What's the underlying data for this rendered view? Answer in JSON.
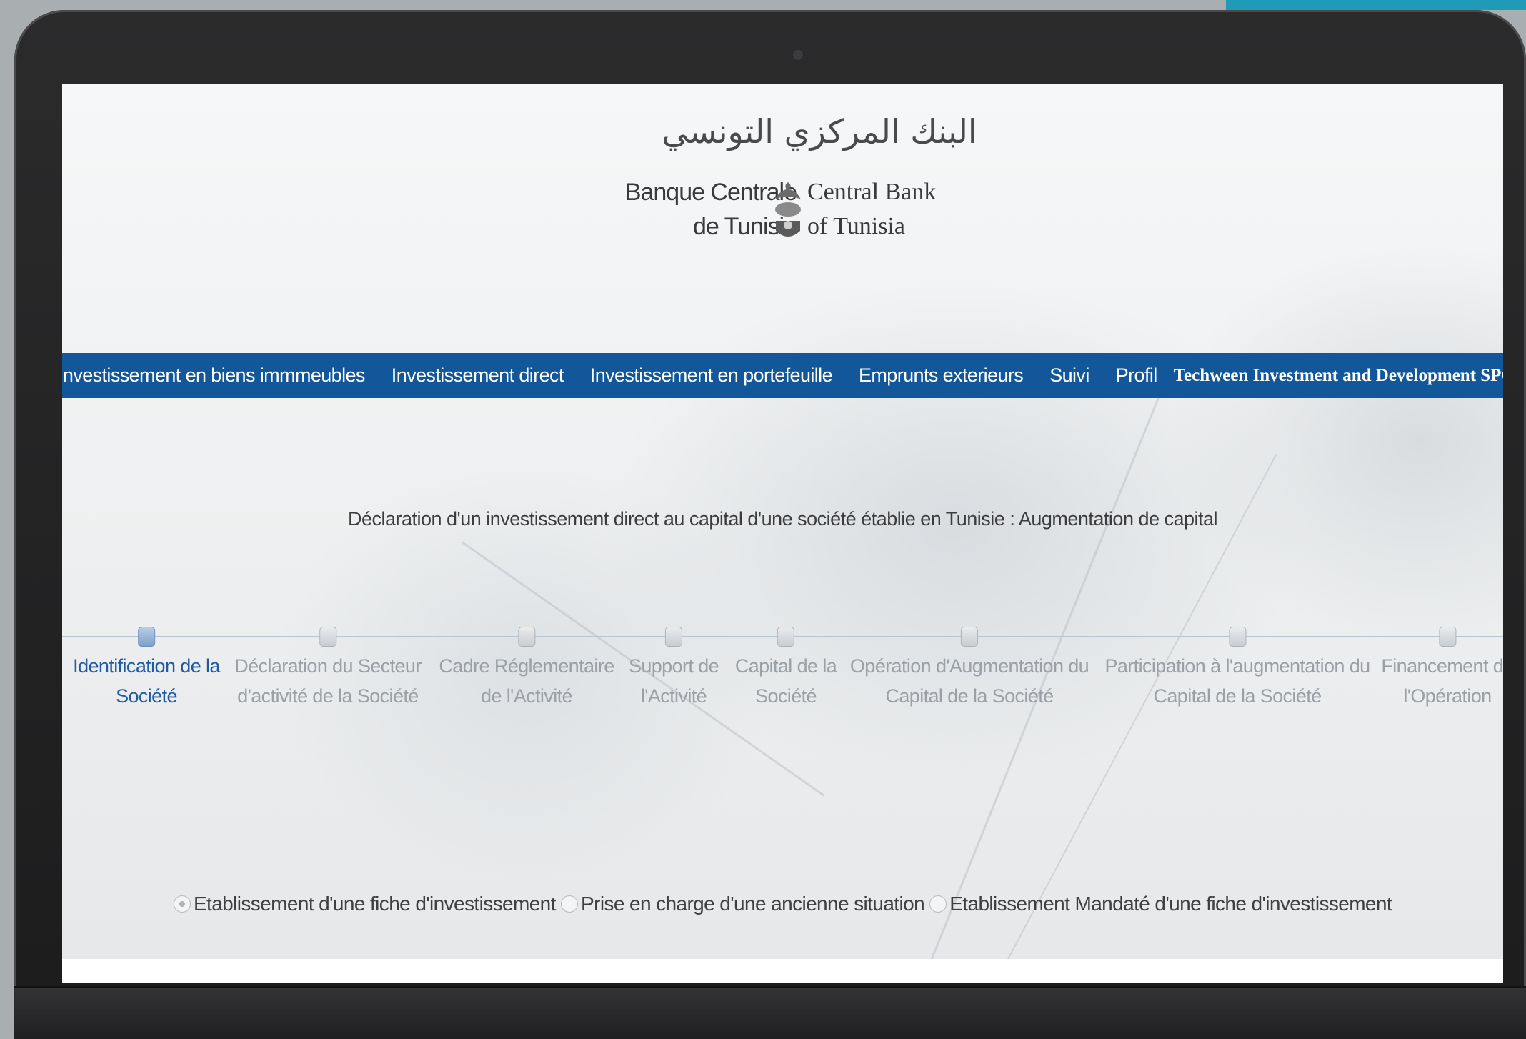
{
  "logo": {
    "arabic": "البنك المركزي التونسي",
    "french_line1": "Banque Centrale",
    "french_line2": "de Tunisie",
    "english_line1": "Central Bank",
    "english_line2": "of Tunisia"
  },
  "navbar": {
    "items": [
      {
        "label": "Investissement en biens immmeubles"
      },
      {
        "label": "Investissement direct"
      },
      {
        "label": "Investissement en portefeuille"
      },
      {
        "label": "Emprunts exterieurs"
      },
      {
        "label": "Suivi"
      },
      {
        "label": "Profil"
      }
    ],
    "company": "Techween Investment and Development SPC",
    "icons": [
      "info-icon",
      "home-icon",
      "power-icon"
    ]
  },
  "page": {
    "title": "Déclaration d'un investissement direct au capital d'une société établie en Tunisie : Augmentation de capital"
  },
  "stepper": {
    "steps": [
      {
        "line1": "Identification de la",
        "line2": "Société",
        "active": true
      },
      {
        "line1": "Déclaration du Secteur",
        "line2": "d'activité de la Société",
        "active": false
      },
      {
        "line1": "Cadre Réglementaire",
        "line2": "de l'Activité",
        "active": false
      },
      {
        "line1": "Support de",
        "line2": "l'Activité",
        "active": false
      },
      {
        "line1": "Capital de la",
        "line2": "Société",
        "active": false
      },
      {
        "line1": "Opération d'Augmentation du",
        "line2": "Capital de la Société",
        "active": false
      },
      {
        "line1": "Participation à l'augmentation du",
        "line2": "Capital de la Société",
        "active": false
      },
      {
        "line1": "Financement de",
        "line2": "l'Opération",
        "active": false
      }
    ]
  },
  "radio_options": {
    "selected": "Etablissement d'une fiche d'investissement",
    "options": [
      {
        "label": "Etablissement d'une fiche d'investissement"
      },
      {
        "label": "Prise en charge d'une ancienne situation"
      },
      {
        "label": "Etablissement Mandaté d'une fiche d'investissement"
      }
    ]
  },
  "colors": {
    "navbar_bg": "#12579a",
    "active_step": "#1f5aa3",
    "inactive_step": "#9aa0a5",
    "accent_corner": "#1f9bb8"
  }
}
